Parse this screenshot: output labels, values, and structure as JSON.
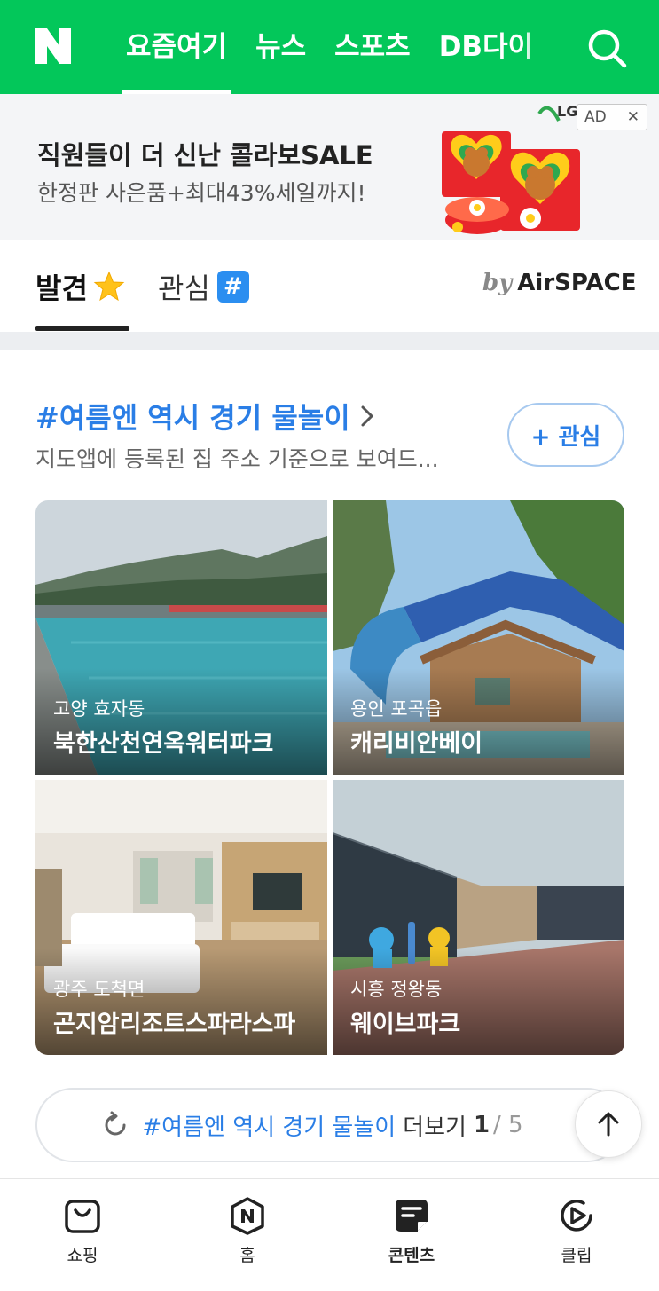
{
  "header": {
    "tabs": [
      {
        "label": "요즘여기",
        "active": true
      },
      {
        "label": "뉴스"
      },
      {
        "label": "스포츠"
      },
      {
        "label": "DB다이"
      }
    ],
    "brand_color": "#03c75a"
  },
  "ad": {
    "title": "직원들이 더 신난 콜라보SALE",
    "subtitle": "한정판 사은품+최대43%세일까지!",
    "brand": "LG",
    "badge": "AD"
  },
  "section_tabs": {
    "discover": "발견",
    "interest": "관심",
    "hash_symbol": "#",
    "provider_prefix": "by",
    "provider": "AirSPACE"
  },
  "topic": {
    "title": "#여름엔 역시 경기 물놀이",
    "description": "지도앱에 등록된 집 주소 기준으로 보여드...",
    "follow_label": "+ 관심"
  },
  "cards": [
    {
      "location": "고양 효자동",
      "name": "북한산천연옥워터파크"
    },
    {
      "location": "용인 포곡읍",
      "name": "캐리비안베이"
    },
    {
      "location": "광주 도척면",
      "name": "곤지암리조트스파라스파"
    },
    {
      "location": "시흥 정왕동",
      "name": "웨이브파크"
    }
  ],
  "more": {
    "topic": "#여름엔 역시 경기 물놀이",
    "label": "더보기",
    "page": "1",
    "total": "/ 5"
  },
  "bottom_nav": [
    {
      "label": "쇼핑",
      "icon": "shopping-bag-icon"
    },
    {
      "label": "홈",
      "icon": "naver-home-icon"
    },
    {
      "label": "콘텐츠",
      "icon": "contents-icon",
      "active": true
    },
    {
      "label": "클립",
      "icon": "clip-play-icon"
    }
  ],
  "accent_color": "#2a7ee6"
}
